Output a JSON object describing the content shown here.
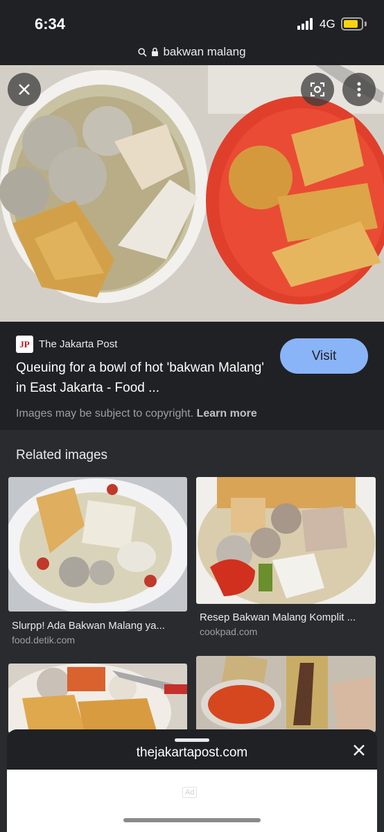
{
  "status_bar": {
    "time": "6:34",
    "network": "4G"
  },
  "url_bar": {
    "url": "bakwan malang"
  },
  "icons": [
    "search-icon",
    "lock-icon",
    "close-icon",
    "lens-icon",
    "more-icon",
    "close-icon"
  ],
  "source": {
    "logo_text": "JP",
    "name": "The Jakarta Post",
    "headline": "Queuing for a bowl of hot 'bakwan Malang' in East Jakarta - Food ...",
    "visit_label": "Visit",
    "copyright": "Images may be subject to copyright.",
    "learn_more": "Learn more"
  },
  "related": {
    "title": "Related images",
    "items": [
      {
        "caption": "Slurpp! Ada Bakwan Malang ya...",
        "source": "food.detik.com"
      },
      {
        "caption": "Resep Bakwan Malang Komplit ...",
        "source": "cookpad.com"
      }
    ]
  },
  "sheet": {
    "title": "thejakartapost.com",
    "ad_label": "Ad"
  },
  "colors": {
    "accent": "#8ab4f8",
    "background": "#202124",
    "battery": "#f8d40c",
    "logo_red": "#c4161c"
  }
}
